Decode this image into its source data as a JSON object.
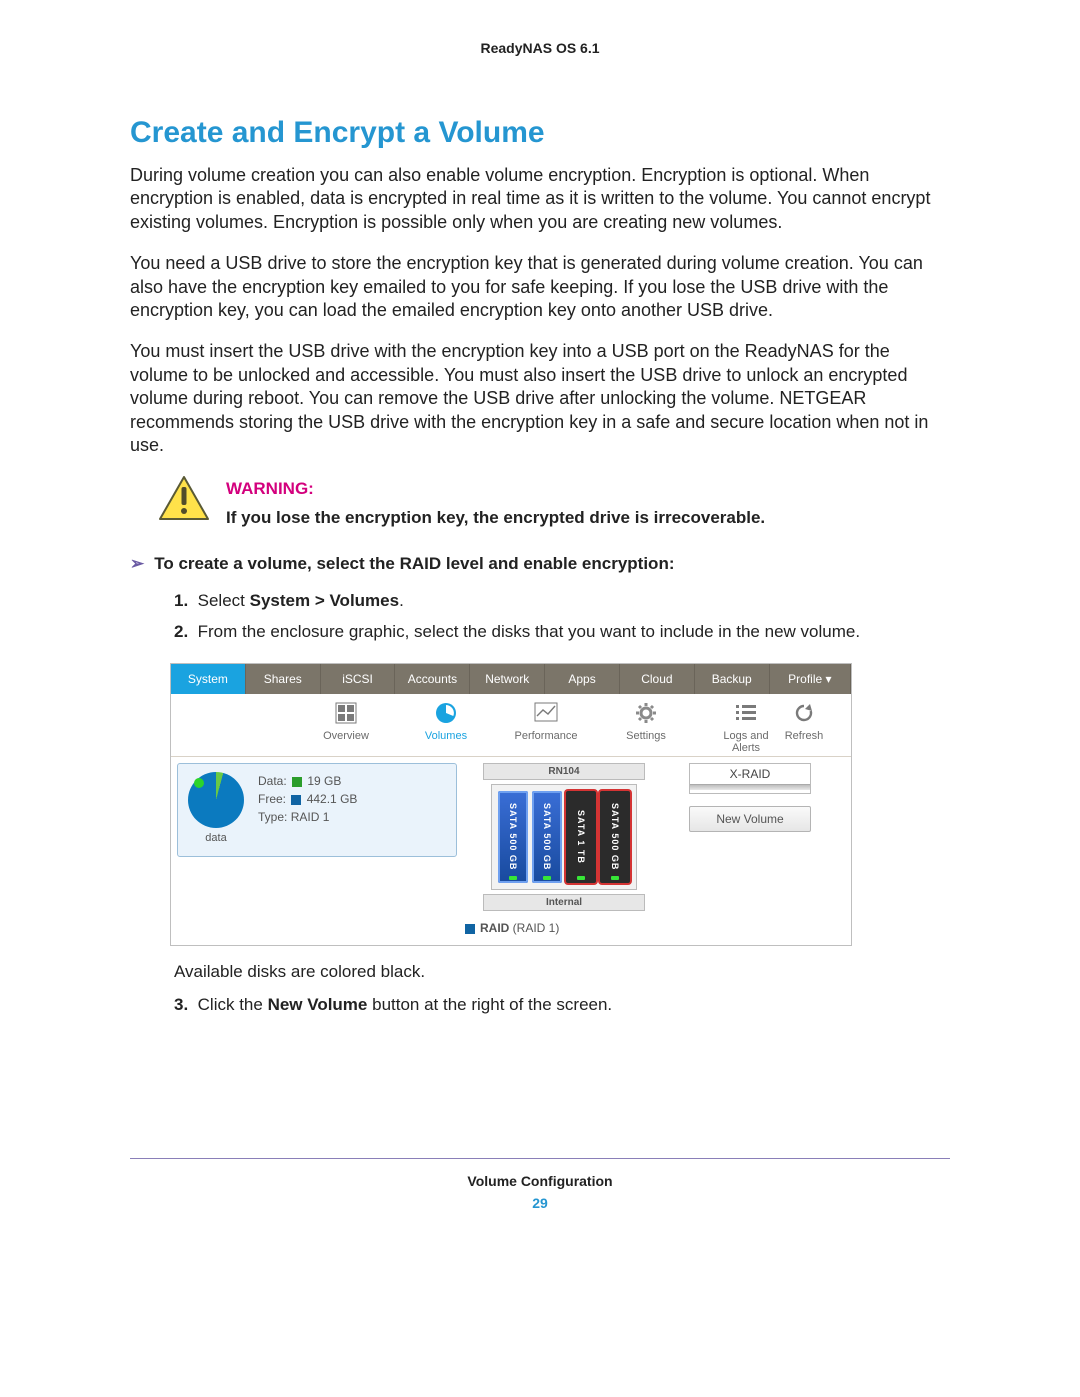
{
  "header": {
    "title": "ReadyNAS OS 6.1"
  },
  "section": {
    "heading": "Create and Encrypt a Volume",
    "para1": "During volume creation you can also enable volume encryption. Encryption is optional. When encryption is enabled, data is encrypted in real time as it is written to the volume. You cannot encrypt existing volumes. Encryption is possible only when you are creating new volumes.",
    "para2": "You need a USB drive to store the encryption key that is generated during volume creation. You can also have the encryption key emailed to you for safe keeping. If you lose the USB drive with the encryption key, you can load the emailed encryption key onto another USB drive.",
    "para3": "You must insert the USB drive with the encryption key into a USB port on the ReadyNAS for the volume to be unlocked and accessible. You must also insert the USB drive to unlock an encrypted volume during reboot. You can remove the USB drive after unlocking the volume. NETGEAR recommends storing the USB drive with the encryption key in a safe and secure location when not in use."
  },
  "warning": {
    "label": "WARNING:",
    "message": "If you lose the encryption key, the encrypted drive is irrecoverable."
  },
  "task": {
    "lead": "To create a volume, select the RAID level and enable encryption:",
    "step1_prefix": "Select ",
    "step1_bold": "System > Volumes",
    "step1_suffix": ".",
    "step2": "From the enclosure graphic, select the disks that you want to include in the new volume.",
    "after_screenshot": "Available disks are colored black.",
    "step3_prefix": "Click the ",
    "step3_bold": "New Volume",
    "step3_suffix": " button at the right of the screen."
  },
  "screenshot": {
    "nav": [
      "System",
      "Shares",
      "iSCSI",
      "Accounts",
      "Network",
      "Apps",
      "Cloud",
      "Backup",
      "Profile ▾"
    ],
    "nav_active": 0,
    "subnav": {
      "overview": "Overview",
      "volumes": "Volumes",
      "performance": "Performance",
      "settings": "Settings",
      "logs": "Logs and Alerts",
      "refresh": "Refresh"
    },
    "volume": {
      "name": "data",
      "data_label": "Data:",
      "data_value": "19 GB",
      "free_label": "Free:",
      "free_value": "442.1 GB",
      "type_label": "Type:",
      "type_value": "RAID 1"
    },
    "enclosure": {
      "model": "RN104",
      "internal": "Internal",
      "bays": [
        {
          "label": "SATA 500 GB",
          "blue": true,
          "sel": false
        },
        {
          "label": "SATA 500 GB",
          "blue": true,
          "sel": false
        },
        {
          "label": "SATA 1 TB",
          "blue": false,
          "sel": true
        },
        {
          "label": "SATA 500 GB",
          "blue": false,
          "sel": true
        }
      ],
      "raid_legend_prefix": "RAID",
      "raid_legend_suffix": "(RAID 1)"
    },
    "actions": {
      "xraid": "X-RAID",
      "newvolume": "New Volume"
    }
  },
  "footer": {
    "section": "Volume Configuration",
    "page": "29"
  }
}
